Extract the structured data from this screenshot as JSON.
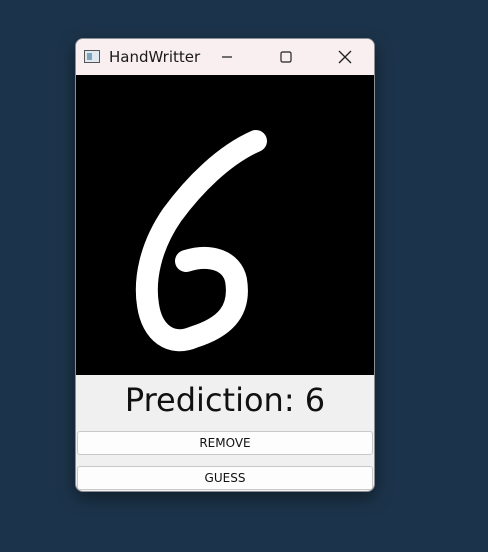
{
  "window": {
    "title": "HandWritter",
    "controls": {
      "minimize_icon": "minimize-icon",
      "maximize_icon": "maximize-icon",
      "close_icon": "close-icon"
    }
  },
  "canvas": {
    "background": "#000000",
    "stroke_color": "#ffffff"
  },
  "prediction_text": "Prediction: 6",
  "buttons": {
    "remove_label": "REMOVE",
    "guess_label": "GUESS"
  }
}
